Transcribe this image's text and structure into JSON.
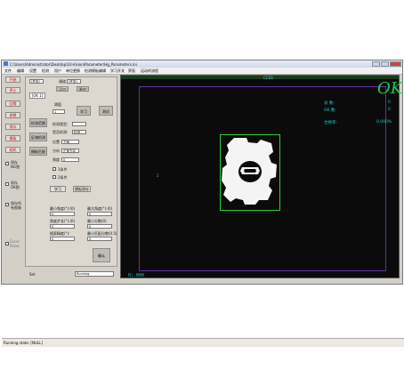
{
  "window": {
    "title": "C:\\Users\\Administrator\\Desktop\\10-Vision\\Parameter\\Hg_Parameters.ini",
    "path_display": "当前配置:C:\\Users\\Administrator\\Desktop\\10-Vision\\Parameter\\Hg_Parameters.ini"
  },
  "menu": [
    "文件",
    "编辑",
    "设置",
    "检测",
    "用户",
    "单位更换",
    "检测模板编辑",
    "学习开关",
    "界面",
    "运动的流程"
  ],
  "left_tools": {
    "btn1": "开始",
    "btn2": "停止",
    "btn3": "回零",
    "btn4": "参数",
    "btn5": "保存",
    "btn6": "模板",
    "btn7": "相机",
    "save_ng": "保存NG图",
    "save_ok": "保存OK图",
    "save_all": "保存所有图像",
    "excel_show": "Excel Show"
  },
  "panel": {
    "top_select": "[任务]",
    "top_label": "通道",
    "top_select2": "[任务]",
    "btn_a": "[添加]",
    "btn_b": "[删除]",
    "tab": "[OK 1]",
    "thresh_label": "阈值",
    "thresh_value": "1",
    "btn_learn": "学习",
    "btn_test": "测试",
    "side_btn1": "检测范围",
    "side_btn2": "区域检测",
    "side_btn3": "模板匹配",
    "row1_label": "检测类型:",
    "row1_value": "",
    "row2_label": "是否检测:",
    "row2_value": "检测",
    "row3_label": "位置",
    "row3_value": "下面",
    "row4_label": "方向",
    "row4_value": "正常方向",
    "row5_label": "角度",
    "row5_value": "0",
    "chk1": "1条件",
    "chk2": "2条件",
    "btn_learn2": "学习",
    "btn_save": "模板保存",
    "f1_label": "最小角度(°):(0)",
    "f1_value": "0",
    "f2_label": "最大角度(°):(0)",
    "f2_value": "0",
    "f3_label": "角度步长(°):(0)",
    "f3_value": "0",
    "f4_label": "最小分数(0)",
    "f4_value": "0",
    "f5_label": "搜索精度(°):",
    "f5_value": "0",
    "f6_label": "最小匹配分数(0.5)",
    "f6_value": "0",
    "apply": "确认",
    "bottom_left": "Set",
    "bottom_right": "Running"
  },
  "status": {
    "state": "Running state: [NULL]",
    "extra": ""
  },
  "view": {
    "cam_label": "CCD1",
    "result": "OK",
    "stat_labels": [
      "总 数:",
      "OK 数:",
      "合格率:"
    ],
    "stat_values": [
      "0",
      "0",
      "0.000%"
    ],
    "coords": "0: 000",
    "side_mark_left": "2",
    "side_mark_right": "2"
  },
  "colors": {
    "ok_green": "#22c64a",
    "stat_cyan": "#1ec8c8",
    "roi_purple": "#6a2fa8",
    "part_roi_green": "#2fcf3a"
  }
}
